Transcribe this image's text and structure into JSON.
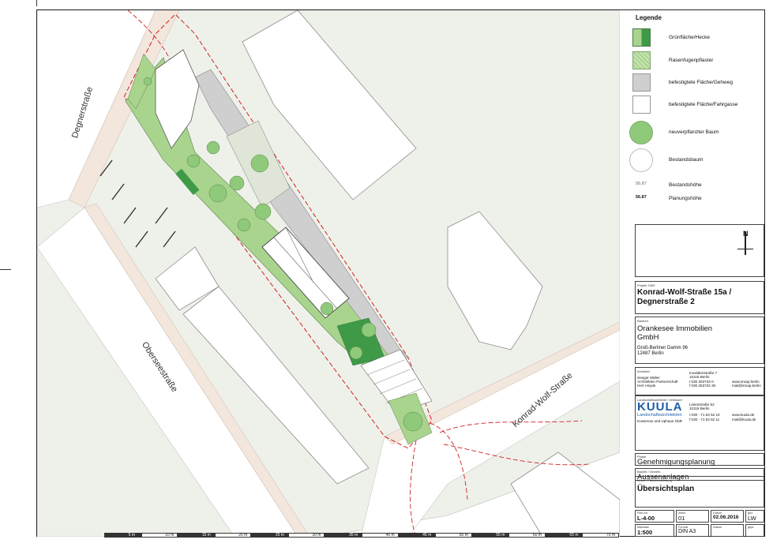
{
  "streets": {
    "degnerstrasse": "Degnerstraße",
    "oberseestrasse": "Oberseestraße",
    "konrad_wolf": "Konrad-Wolf-Straße"
  },
  "legend": {
    "title": "Legende",
    "items": [
      {
        "label": "Grünfläche/Hecke"
      },
      {
        "label": "Rasenfugenpflaster"
      },
      {
        "label": "befestigtete Fläche/Gehweg"
      },
      {
        "label": "befestigtete Fläche/Fahrgasse"
      },
      {
        "label": "neuverpflanzter Baum"
      },
      {
        "label": "Bestandsbaum"
      },
      {
        "label": "Bestandshöhe",
        "value": "56.87"
      },
      {
        "label": "Planungshöhe",
        "value": "56.87"
      }
    ],
    "colors": {
      "green_light": "#a9d48e",
      "green_dark": "#3f9a48",
      "paving": "#cfcfcf",
      "tree_new": "#8fc97a"
    }
  },
  "north": {
    "letter": "N"
  },
  "project": {
    "label": "Projekt 1505",
    "title_line1": "Konrad-Wolf-Straße 15a /",
    "title_line2": "Degnerstraße  2"
  },
  "client": {
    "label": "Bauherr",
    "name_line1": "Orankesee Immobilien",
    "name_line2": "GmbH",
    "address_line1": "Groß-Berliner Damm 96",
    "address_line2": "12487 Berlin"
  },
  "architect": {
    "label": "Architekt",
    "lines": [
      "Seeger Müller",
      "Architekten Partnerschaft",
      "Herr Heyde"
    ],
    "street": "Invalidenstraße 7",
    "city": "10115 Berlin",
    "tel": "t   030 253734 0",
    "fax": "f   030 253734 30",
    "web": "www.smap.berlin",
    "mail": "mail@smap.berlin"
  },
  "landscape": {
    "label": "Landschaftsarchitekt / Verfasser",
    "logo_text": "KUULA",
    "logo_sub": "Landschaftsarchitekten",
    "partners": "Kusserow und Uphaus GbR",
    "street": "Linienstraße 52",
    "city": "10119 Berlin",
    "tel": "t   030 - 71 53 52 10",
    "fax": "f   030 - 71 53 52 11",
    "web": "www.kuula.de",
    "mail": "mail@kuula.de"
  },
  "phase": {
    "label": "Phase",
    "value": "Genehmigungsplanung"
  },
  "trade": {
    "label": "Bauteil / Gewerk",
    "value": "Aussenanlagen"
  },
  "content": {
    "label": "Inhalt / Planbezeichnung",
    "value": "Übersichtsplan"
  },
  "plan_info": {
    "plan_nr_label": "Plan-Nr.",
    "plan_nr": "L-4-00",
    "index_label": "Index",
    "index": "01",
    "date_label": "Datum",
    "date": "02.06.2016",
    "drawn_label": "gez.",
    "drawn": "LW",
    "scale_label": "Maßstab",
    "scale": "1:500",
    "format_label": "Format",
    "format": "DIN A3",
    "date2_label": "Datum",
    "signed_label": "gepr."
  },
  "scalebar": [
    "5 m",
    "10 m",
    "15 m",
    "20 m",
    "25 m",
    "30 m",
    "35 m",
    "40 m",
    "45 m",
    "50 m",
    "55 m",
    "60 m",
    "65 m",
    "70 m"
  ]
}
